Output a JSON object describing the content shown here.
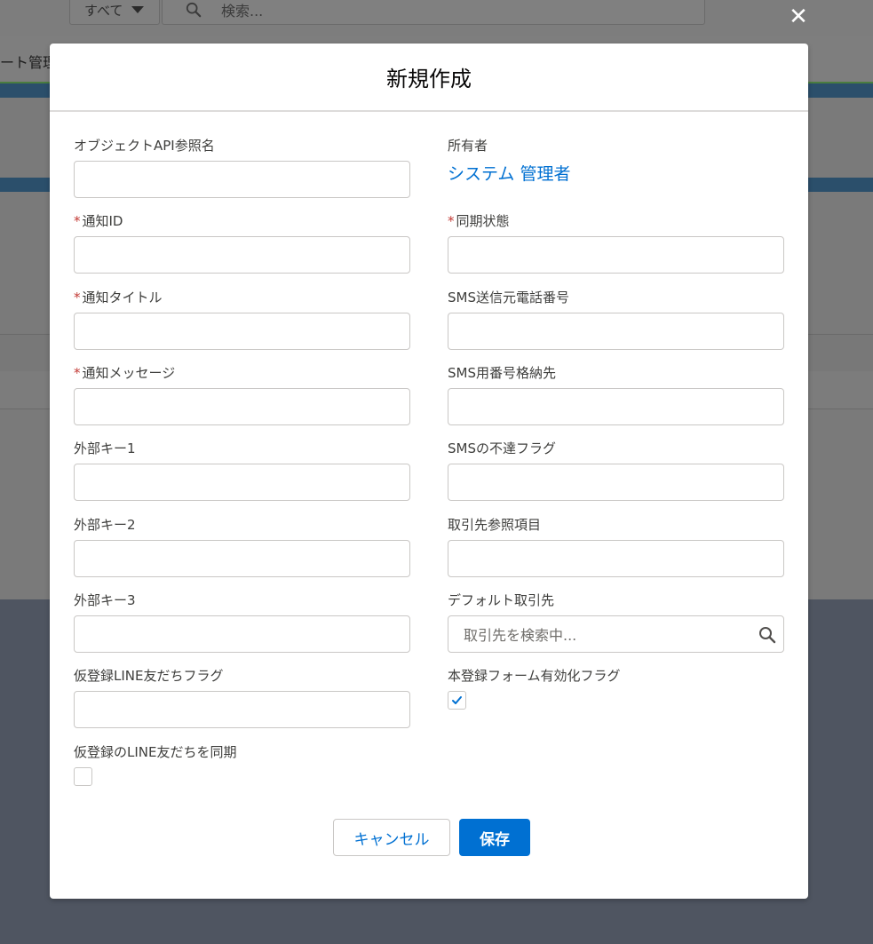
{
  "background": {
    "scope_label": "すべて",
    "search_placeholder": "検索...",
    "nav_label": "ート管理"
  },
  "modal": {
    "title": "新規作成",
    "fields_left": [
      {
        "label": "オブジェクトAPI参照名",
        "required": false,
        "value": ""
      },
      {
        "label": "通知ID",
        "required": true,
        "value": ""
      },
      {
        "label": "通知タイトル",
        "required": true,
        "value": ""
      },
      {
        "label": "通知メッセージ",
        "required": true,
        "value": ""
      },
      {
        "label": "外部キー1",
        "required": false,
        "value": ""
      },
      {
        "label": "外部キー2",
        "required": false,
        "value": ""
      },
      {
        "label": "外部キー3",
        "required": false,
        "value": ""
      },
      {
        "label": "仮登録LINE友だちフラグ",
        "required": false,
        "value": ""
      },
      {
        "label": "仮登録のLINE友だちを同期",
        "type": "checkbox",
        "checked": false
      }
    ],
    "fields_right": [
      {
        "label": "所有者",
        "type": "link",
        "value": "システム 管理者"
      },
      {
        "label": "同期状態",
        "required": true,
        "value": ""
      },
      {
        "label": "SMS送信元電話番号",
        "required": false,
        "value": ""
      },
      {
        "label": "SMS用番号格納先",
        "required": false,
        "value": ""
      },
      {
        "label": "SMSの不達フラグ",
        "required": false,
        "value": ""
      },
      {
        "label": "取引先参照項目",
        "required": false,
        "value": ""
      },
      {
        "label": "デフォルト取引先",
        "type": "lookup",
        "placeholder": "取引先を検索中..."
      },
      {
        "label": "本登録フォーム有効化フラグ",
        "type": "checkbox",
        "checked": true
      }
    ],
    "required_mark": "*",
    "buttons": {
      "cancel": "キャンセル",
      "save": "保存"
    }
  },
  "colors": {
    "accent": "#0070d2",
    "required": "#c23934",
    "overlay": "#4f5561"
  },
  "icons": {
    "close": "close-icon",
    "search": "search-icon",
    "check": "check-icon",
    "dropdown": "chevron-down-icon"
  }
}
